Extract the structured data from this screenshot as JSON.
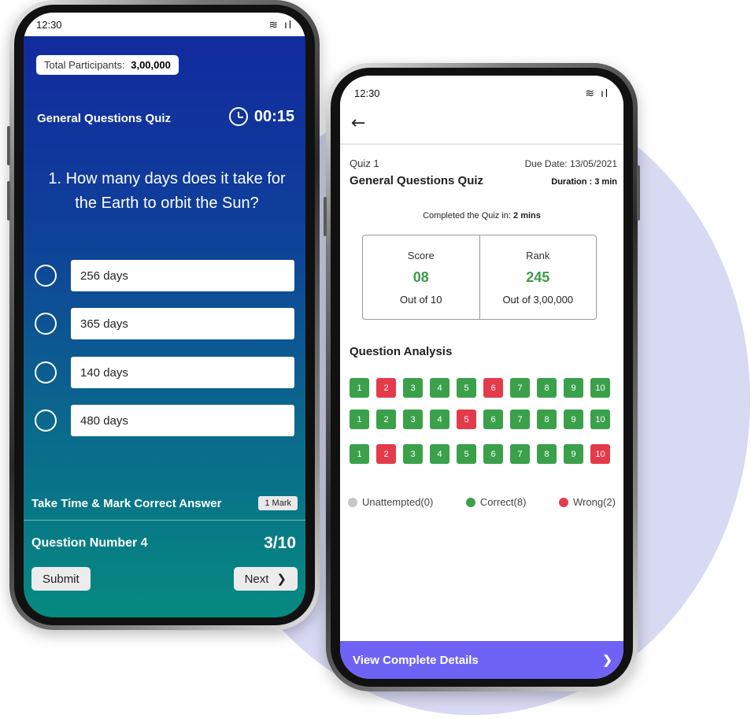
{
  "left_phone": {
    "status": {
      "time": "12:30",
      "icons": "wifi-icon signal-icon"
    },
    "participants": {
      "label": "Total Participants:",
      "value": "3,00,000"
    },
    "quiz_title": "General Questions Quiz",
    "timer": "00:15",
    "question": "1. How many days does it take for the Earth to orbit the Sun?",
    "options": [
      "256 days",
      "365 days",
      "140 days",
      "480 days"
    ],
    "instruction": "Take Time & Mark Correct Answer",
    "mark_badge": "1 Mark",
    "question_number_label": "Question Number 4",
    "progress": "3/10",
    "submit_label": "Submit",
    "next_label": "Next"
  },
  "right_phone": {
    "status": {
      "time": "12:30"
    },
    "quiz_no": "Quiz 1",
    "due_date": "Due Date: 13/05/2021",
    "quiz_title": "General Questions Quiz",
    "duration": "Duration : 3 min",
    "completed_prefix": "Completed the Quiz in:",
    "completed_value": "2 mins",
    "score": {
      "label": "Score",
      "value": "08",
      "sub": "Out of 10"
    },
    "rank": {
      "label": "Rank",
      "value": "245",
      "sub": "Out of 3,00,000"
    },
    "analysis_title": "Question Analysis",
    "analysis_rows": [
      [
        "correct",
        "wrong",
        "correct",
        "correct",
        "correct",
        "wrong",
        "correct",
        "correct",
        "correct",
        "correct"
      ],
      [
        "correct",
        "correct",
        "correct",
        "correct",
        "wrong",
        "correct",
        "correct",
        "correct",
        "correct",
        "correct"
      ],
      [
        "correct",
        "wrong",
        "correct",
        "correct",
        "correct",
        "correct",
        "correct",
        "correct",
        "correct",
        "wrong"
      ]
    ],
    "legend": {
      "unattempted": "Unattempted(0)",
      "correct": "Correct(8)",
      "wrong": "Wrong(2)"
    },
    "view_details": "View Complete Details"
  },
  "colors": {
    "correct": "#3aa14a",
    "wrong": "#e43b4b",
    "unattempted": "#c7c7c7",
    "accent": "#6e63f5",
    "score_green": "#3c9d47"
  }
}
